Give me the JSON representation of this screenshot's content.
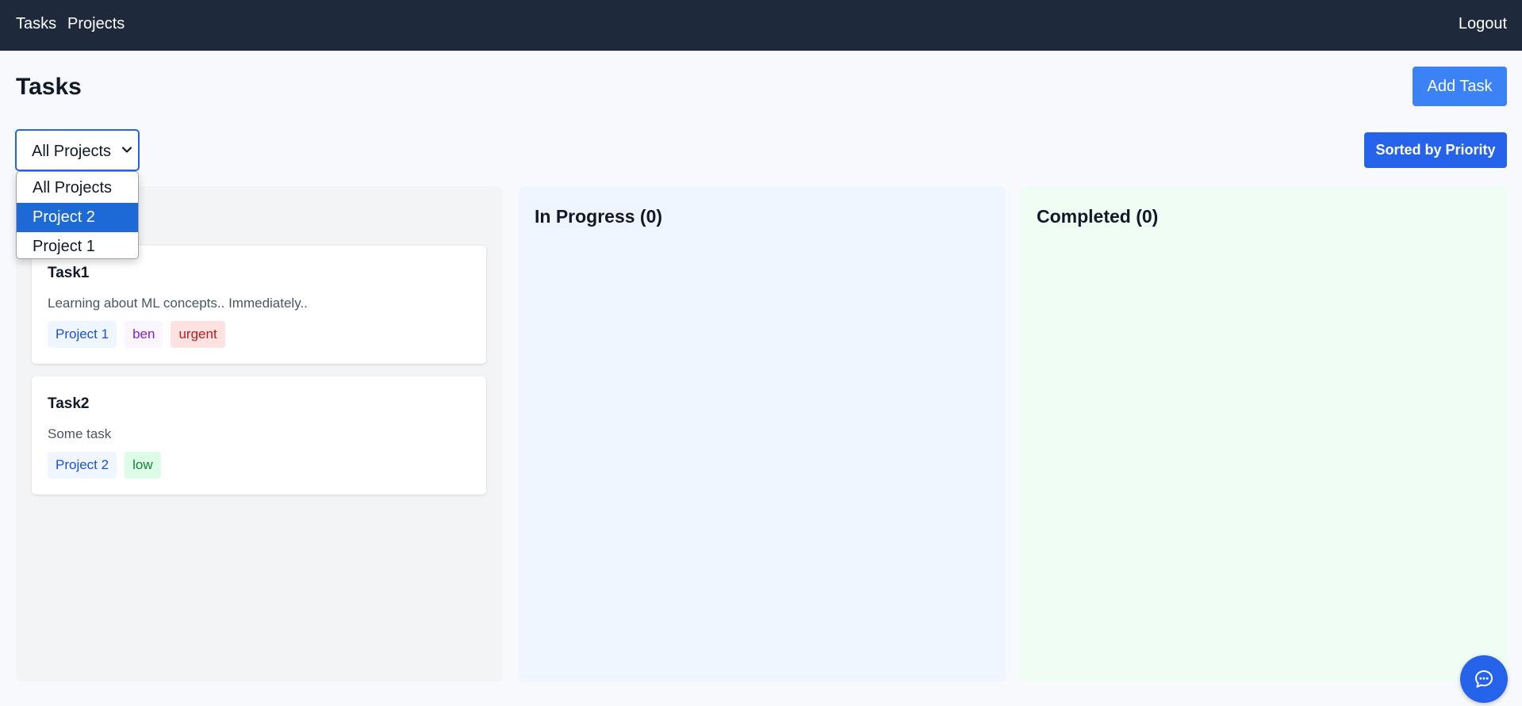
{
  "nav": {
    "links": [
      {
        "label": "Tasks"
      },
      {
        "label": "Projects"
      }
    ],
    "logout_label": "Logout",
    "background_color": "#1e293b"
  },
  "header": {
    "title": "Tasks",
    "add_task_label": "Add Task"
  },
  "filter": {
    "selected_value": "All Projects",
    "options": [
      {
        "label": "All Projects",
        "highlighted": false
      },
      {
        "label": "Project 2",
        "highlighted": true
      },
      {
        "label": "Project 1",
        "highlighted": false
      }
    ],
    "open": true
  },
  "sort_button_label": "Sorted by Priority",
  "columns": [
    {
      "id": "todo",
      "title": "",
      "background_color": "#f3f4f6",
      "tasks": [
        {
          "title": "Task1",
          "description": "Learning about ML concepts.. Immediately..",
          "tags": [
            {
              "label": "Project 1",
              "kind": "project"
            },
            {
              "label": "ben",
              "kind": "user"
            },
            {
              "label": "urgent",
              "kind": "priority-urgent"
            }
          ]
        },
        {
          "title": "Task2",
          "description": "Some task",
          "tags": [
            {
              "label": "Project 2",
              "kind": "project"
            },
            {
              "label": "low",
              "kind": "priority-low"
            }
          ]
        }
      ]
    },
    {
      "id": "in-progress",
      "title": "In Progress (0)",
      "background_color": "#eff6ff",
      "tasks": []
    },
    {
      "id": "completed",
      "title": "Completed (0)",
      "background_color": "#f0fdf4",
      "tasks": []
    }
  ],
  "chat": {
    "icon": "chat-bubble-icon"
  },
  "colors": {
    "primary": "#2563eb",
    "add_button": "#3b82f6",
    "dropdown_highlight": "#1d6ad6"
  }
}
